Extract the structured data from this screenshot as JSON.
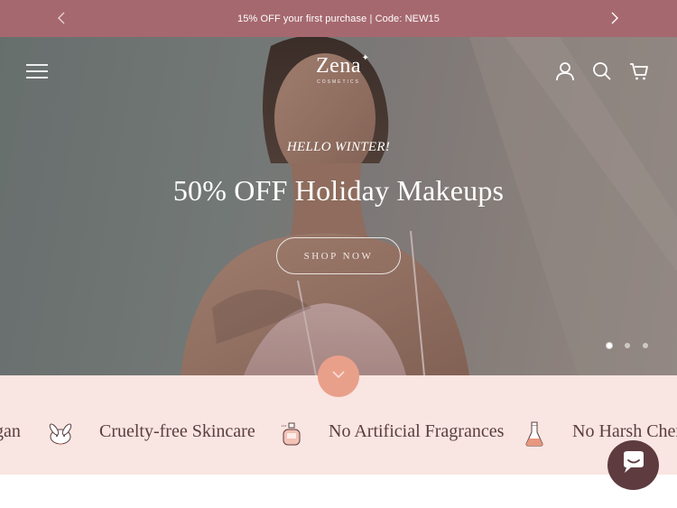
{
  "announcement": {
    "text": "15% OFF your first purchase | Code: NEW15"
  },
  "header": {
    "logo_word": "Zena",
    "logo_sub": "COSMETICS"
  },
  "hero": {
    "kicker": "HELLO WINTER!",
    "title": "50% OFF Holiday Makeups",
    "cta_label": "SHOP NOW",
    "slides_total": 3,
    "active_slide": 1
  },
  "features": {
    "items": [
      {
        "label": "gan",
        "icon": "none"
      },
      {
        "label": "Cruelty-free Skincare",
        "icon": "bunny-icon"
      },
      {
        "label": "No Artificial Fragrances",
        "icon": "perfume-bottle-icon"
      },
      {
        "label": "No Harsh Chem",
        "icon": "flask-icon"
      }
    ]
  },
  "colors": {
    "announcement_bg": "#a6686f",
    "features_bg": "#f9e5e1",
    "accent_circle": "#e9a08b",
    "chat_bg": "#5e3b3f",
    "feature_text": "#5b3d3f"
  }
}
